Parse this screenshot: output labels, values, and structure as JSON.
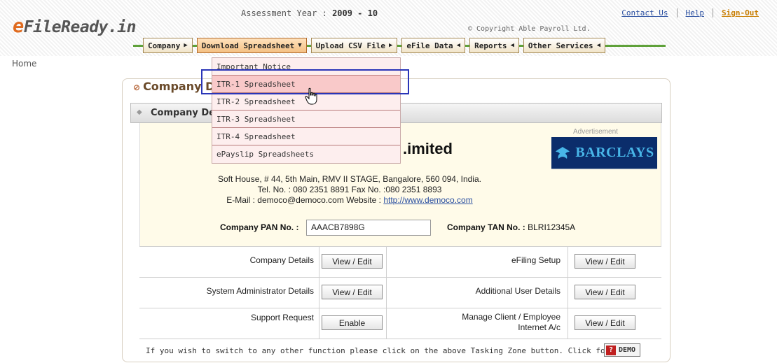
{
  "header": {
    "logo_prefix": "e",
    "logo_rest": "FileReady.in",
    "assessment_label": "Assessment Year :",
    "assessment_value": "2009 - 10",
    "copyright": "© Copyright Able Payroll Ltd.",
    "links": [
      "Contact Us",
      "Help",
      "Sign-Out"
    ]
  },
  "nav": {
    "items": [
      {
        "label": "Company",
        "arrow": "▶"
      },
      {
        "label": "Download Spreadsheet",
        "arrow": "▼"
      },
      {
        "label": "Upload CSV File",
        "arrow": "▶"
      },
      {
        "label": "eFile Data",
        "arrow": "◀"
      },
      {
        "label": "Reports",
        "arrow": "◀"
      },
      {
        "label": "Other Services",
        "arrow": "◀"
      }
    ]
  },
  "dropdown": {
    "items": [
      "Important Notice",
      "ITR-1 Spreadsheet",
      "ITR-2 Spreadsheet",
      "ITR-3 Spreadsheet",
      "ITR-4 Spreadsheet",
      "ePayslip Spreadsheets"
    ]
  },
  "breadcrumb": "Home",
  "panel": {
    "title": "Company De",
    "section": "Company Det",
    "company_name": ".imited",
    "address_line1": "Soft House, # 44, 5th Main, RMV II STAGE, Bangalore, 560 094, India.",
    "address_line2": "Tel. No. : 080 2351 8891   Fax No. :080 2351 8893",
    "email_label": "E-Mail : democo@democo.com   Website : ",
    "website": "http://www.democo.com",
    "pan_label": "Company PAN No. :",
    "pan_value": "AAACB7898G",
    "tan_label": "Company TAN No. :",
    "tan_value": "BLRI12345A"
  },
  "ad": {
    "label": "Advertisement",
    "brand": "BARCLAYS"
  },
  "grid": {
    "rows": [
      {
        "left_label": "Company Details",
        "left_button": "View / Edit",
        "right_label": "eFiling Setup",
        "right_button": "View / Edit"
      },
      {
        "left_label": "System Administrator Details",
        "left_button": "View / Edit",
        "right_label": "Additional User Details",
        "right_button": "View / Edit"
      },
      {
        "left_label": "Support Request",
        "left_button": "Enable",
        "right_label": "Manage Client / Employee\nInternet A/c",
        "right_button": "View / Edit"
      }
    ]
  },
  "footer": {
    "note": "If you wish to switch to any other function please click on the above Tasking Zone button. Click for a",
    "demo_label": "DEMO",
    "demo_icon": "?"
  },
  "colors": {
    "accent": "#e06b1f",
    "nav_line": "#5fa13a",
    "highlight": "#2a35b8",
    "ad_bg": "#0b2d6b"
  }
}
